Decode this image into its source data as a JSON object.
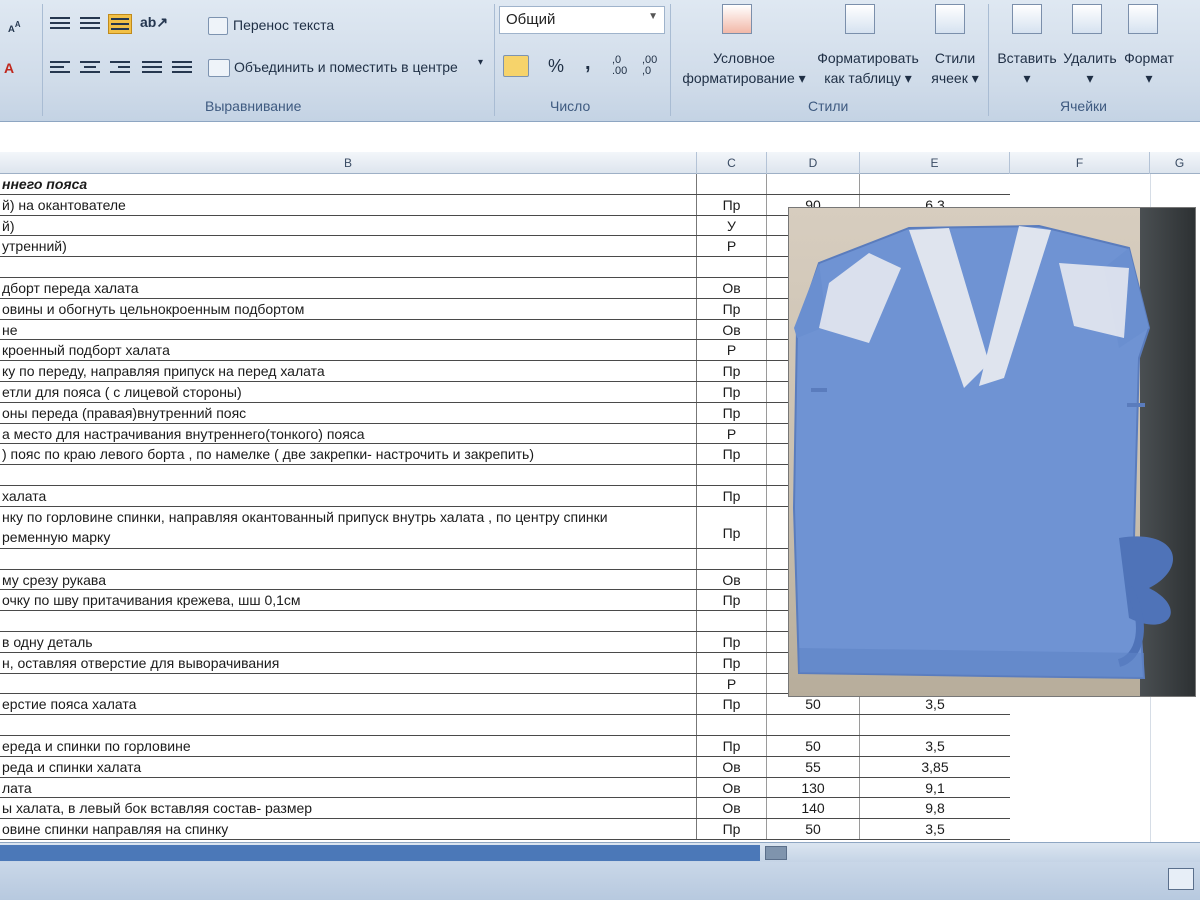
{
  "ribbon": {
    "wrap_text": "Перенос текста",
    "merge_center": "Объединить и поместить в центре",
    "alignment_group": "Выравнивание",
    "number_format": "Общий",
    "number_group": "Число",
    "percent": "%",
    "comma": ",",
    "conditional_formatting_1": "Условное",
    "conditional_formatting_2": "форматирование",
    "format_table_1": "Форматировать",
    "format_table_2": "как таблицу",
    "cell_styles_1": "Стили",
    "cell_styles_2": "ячеек",
    "styles_group": "Стили",
    "insert": "Вставить",
    "delete": "Удалить",
    "format": "Формат",
    "cells_group": "Ячейки"
  },
  "columns": [
    "B",
    "C",
    "D",
    "E",
    "F",
    "G"
  ],
  "rows": [
    {
      "b": "ннего пояса",
      "c": "",
      "d": "",
      "e": "",
      "bold": true
    },
    {
      "b": "й)  на окантователе",
      "c": "Пр",
      "d": "90",
      "e": "6,3"
    },
    {
      "b": "й)",
      "c": "У",
      "d": "",
      "e": ""
    },
    {
      "b": "утренний)",
      "c": "Р",
      "d": "",
      "e": ""
    },
    {
      "b": "",
      "c": "",
      "d": "",
      "e": ""
    },
    {
      "b": "дборт переда халата",
      "c": "Ов",
      "d": "",
      "e": ""
    },
    {
      "b": "овины и обогнуть цельнокроенным подбортом",
      "c": "Пр",
      "d": "",
      "e": ""
    },
    {
      "b": "не",
      "c": "Ов",
      "d": "",
      "e": ""
    },
    {
      "b": "кроенный подборт халата",
      "c": "Р",
      "d": "",
      "e": ""
    },
    {
      "b": "ку по переду, направляя припуск на перед халата",
      "c": "Пр",
      "d": "",
      "e": ""
    },
    {
      "b": "етли для пояса ( с лицевой стороны)",
      "c": "Пр",
      "d": "",
      "e": ""
    },
    {
      "b": "оны переда (правая)внутренний пояс",
      "c": "Пр",
      "d": "",
      "e": ""
    },
    {
      "b": "а место для настрачивания внутреннего(тонкого) пояса",
      "c": "Р",
      "d": "",
      "e": ""
    },
    {
      "b": ") пояс по краю левого борта , по намелке ( две закрепки- настрочить и закрепить)",
      "c": "Пр",
      "d": "",
      "e": ""
    },
    {
      "b": "",
      "c": "",
      "d": "",
      "e": ""
    },
    {
      "b": " халата",
      "c": "Пр",
      "d": "",
      "e": ""
    },
    {
      "b": "нку по горловине спинки, направляя окантованный припуск внутрь халата , по центру спинки",
      "b2": "ременную марку",
      "c": "Пр",
      "d": "",
      "e": "",
      "tall": true
    },
    {
      "b": "",
      "c": "",
      "d": "",
      "e": ""
    },
    {
      "b": "му срезу рукава",
      "c": "Ов",
      "d": "",
      "e": ""
    },
    {
      "b": "очку по шву притачивания крежева, шш 0,1см",
      "c": "Пр",
      "d": "",
      "e": ""
    },
    {
      "b": "",
      "c": "",
      "d": "",
      "e": ""
    },
    {
      "b": " в одну деталь",
      "c": "Пр",
      "d": "",
      "e": ""
    },
    {
      "b": "н, оставляя отверстие для выворачивания",
      "c": "Пр",
      "d": "",
      "e": ""
    },
    {
      "b": "",
      "c": "Р",
      "d": "",
      "e": ""
    },
    {
      "b": "ерстие пояса халата",
      "c": "Пр",
      "d": "50",
      "e": "3,5"
    },
    {
      "b": "",
      "c": "",
      "d": "",
      "e": ""
    },
    {
      "b": "ереда и спинки по горловине",
      "c": "Пр",
      "d": "50",
      "e": "3,5"
    },
    {
      "b": "реда и спинки халата",
      "c": "Ов",
      "d": "55",
      "e": "3,85"
    },
    {
      "b": "лата",
      "c": "Ов",
      "d": "130",
      "e": "9,1"
    },
    {
      "b": "ы халата, в левый бок вставляя состав- размер",
      "c": "Ов",
      "d": "140",
      "e": "9,8"
    },
    {
      "b": "овине спинки направляя на спинку",
      "c": "Пр",
      "d": "50",
      "e": "3,5"
    }
  ],
  "colors": {
    "robe": "#6f93d3",
    "lace": "#dfe4ee",
    "ribbon_bg": "#cfdbe9"
  }
}
